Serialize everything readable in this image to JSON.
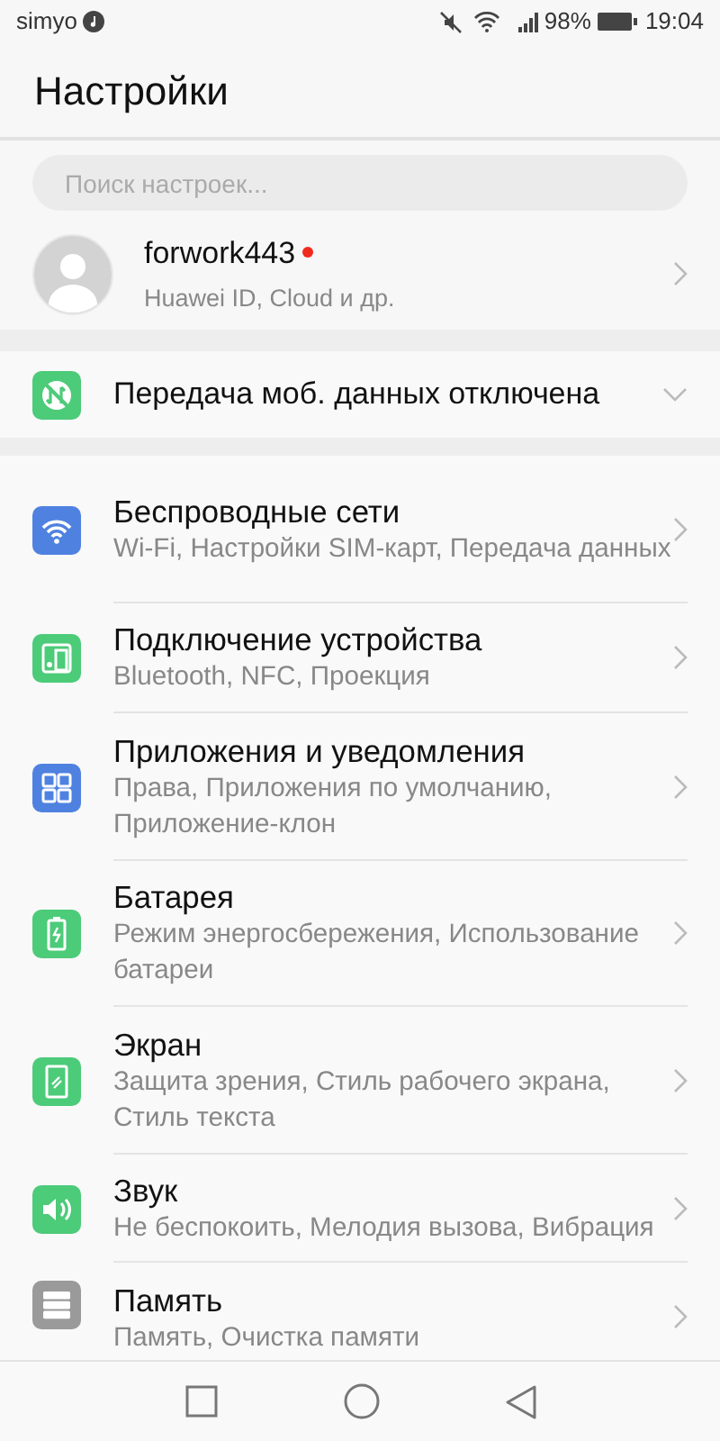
{
  "status_bar": {
    "carrier": "simyo",
    "battery_percent": "98%",
    "time": "19:04"
  },
  "header": {
    "title": "Настройки"
  },
  "search": {
    "placeholder": "Поиск настроек..."
  },
  "account": {
    "name": "forwork443",
    "subtitle": "Huawei ID, Cloud и др.",
    "notification": true
  },
  "mobile_data": {
    "label": "Передача моб. данных отключена",
    "expanded": false
  },
  "items": [
    {
      "kind": "wifi",
      "color": "#4f82e0",
      "title": "Беспроводные сети",
      "subtitle": "Wi-Fi, Настройки SIM-карт, Передача данных"
    },
    {
      "kind": "device",
      "color": "#4ccb79",
      "title": "Подключение устройства",
      "subtitle": "Bluetooth, NFC, Проекция"
    },
    {
      "kind": "apps",
      "color": "#4f82e0",
      "title": "Приложения и уведомления",
      "subtitle": "Права, Приложения по умолчанию, Приложение-клон"
    },
    {
      "kind": "battery",
      "color": "#4ccb79",
      "title": "Батарея",
      "subtitle": "Режим энергосбережения, Использование батареи"
    },
    {
      "kind": "screen",
      "color": "#4ccb79",
      "title": "Экран",
      "subtitle": "Защита зрения, Стиль рабочего экрана, Стиль текста"
    },
    {
      "kind": "sound",
      "color": "#4ccb79",
      "title": "Звук",
      "subtitle": "Не беспокоить, Мелодия вызова, Вибрация"
    },
    {
      "kind": "storage",
      "color": "#9a9a9a",
      "title": "Память",
      "subtitle": "Память, Очистка памяти"
    }
  ]
}
